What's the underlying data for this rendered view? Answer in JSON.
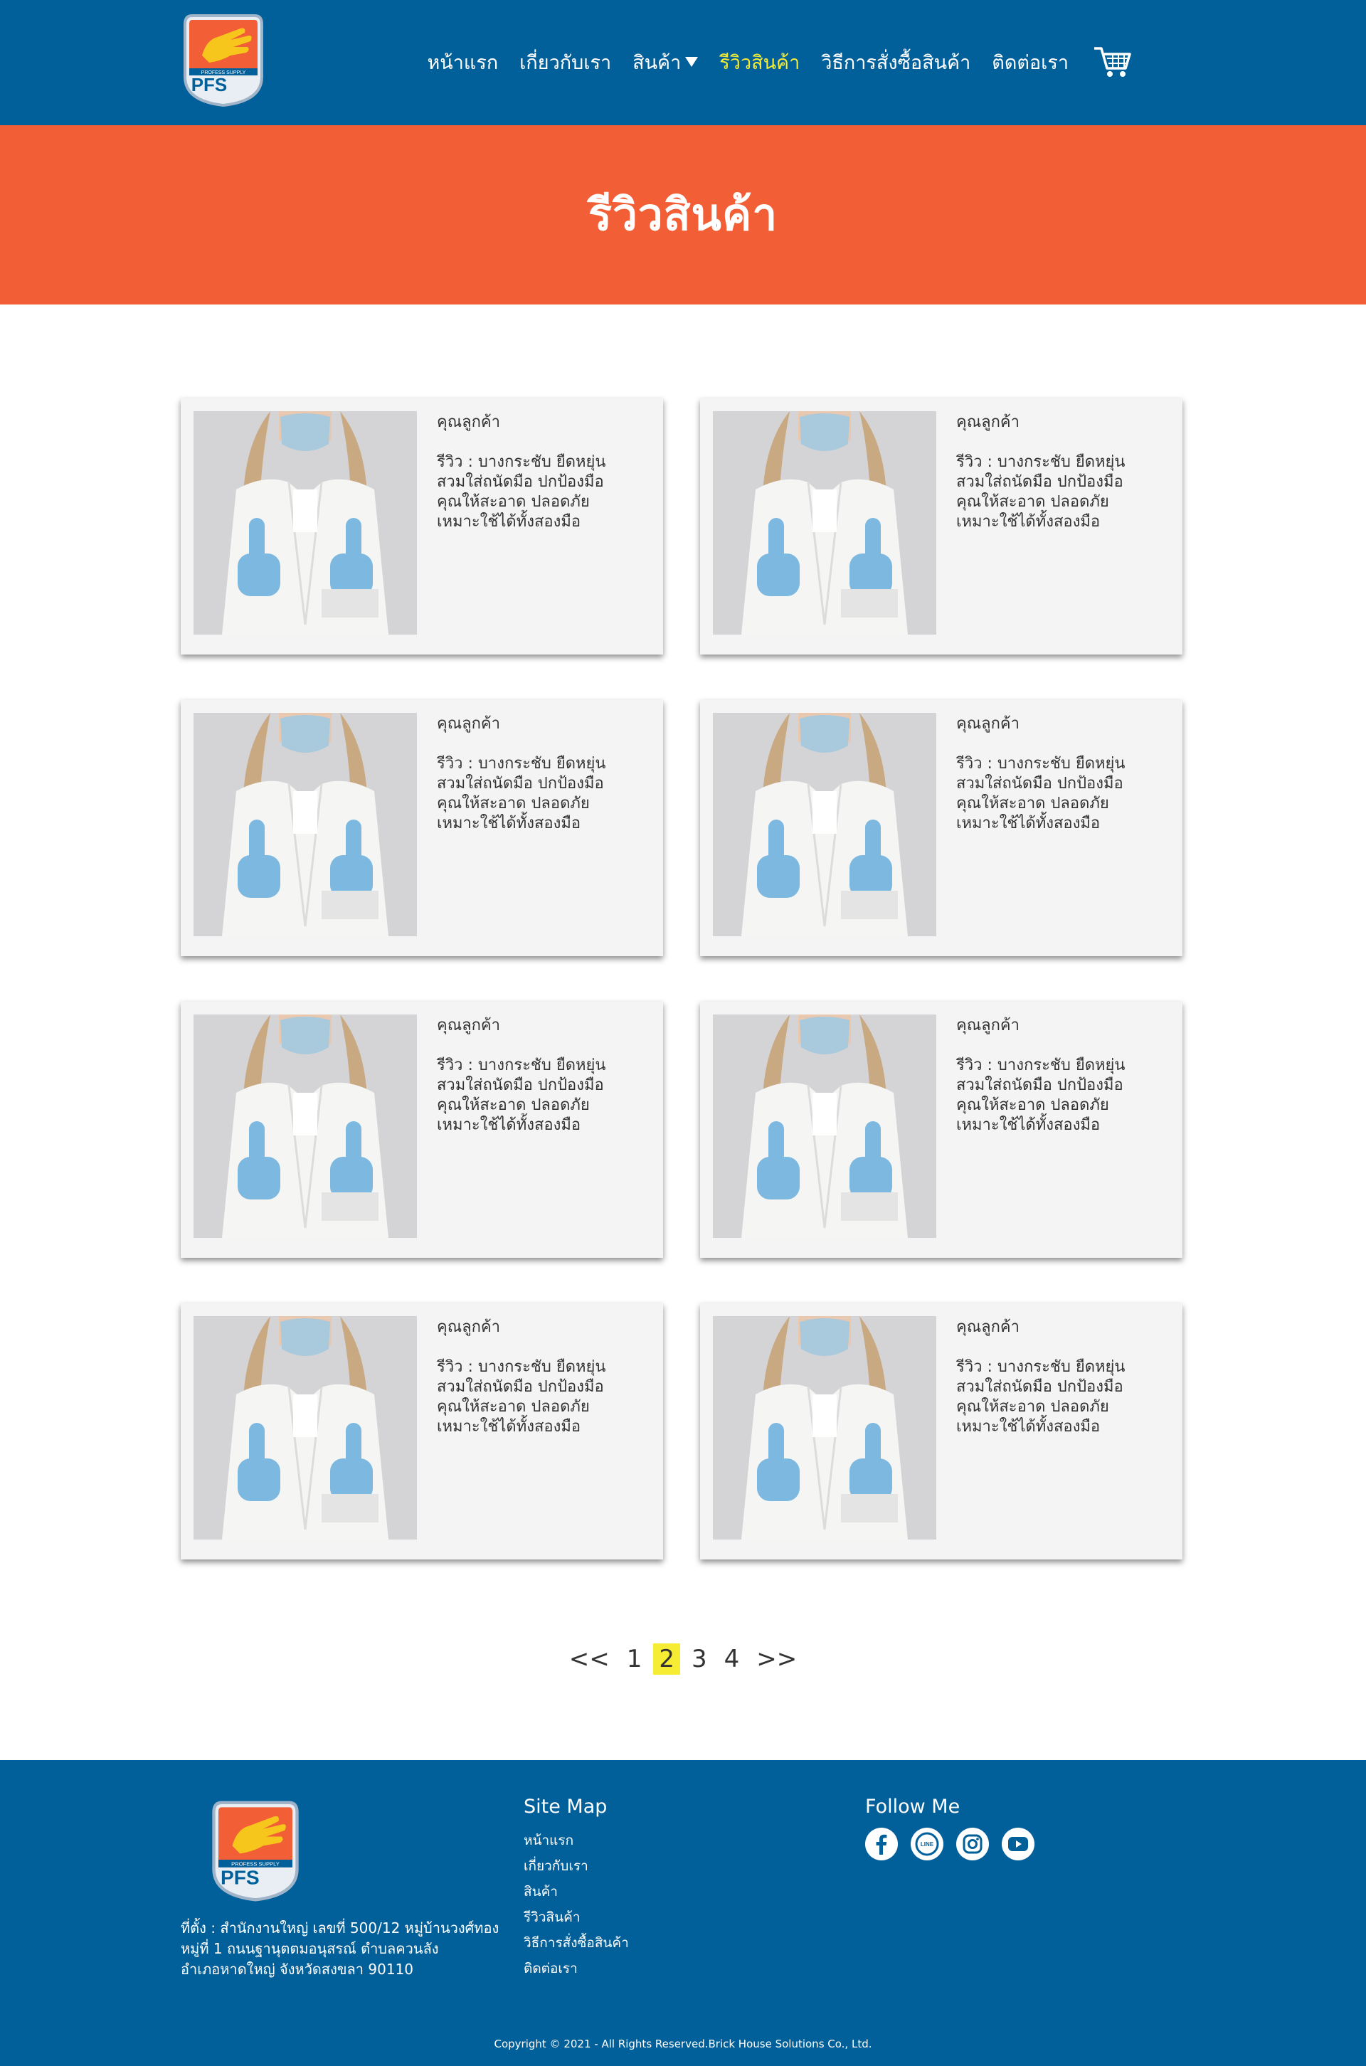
{
  "header": {
    "logo_text": "PFS",
    "logo_ribbon": "PROFESS SUPPLY",
    "nav": [
      {
        "label": "หน้าแรก",
        "active": false
      },
      {
        "label": "เกี่ยวกับเรา",
        "active": false
      },
      {
        "label": "สินค้า",
        "active": false,
        "dropdown": true
      },
      {
        "label": "รีวิวสินค้า",
        "active": true
      },
      {
        "label": "วิธีการสั่งซื้อสินค้า",
        "active": false
      },
      {
        "label": "ติดต่อเรา",
        "active": false
      }
    ],
    "cart_icon": "shopping-cart-icon"
  },
  "hero": {
    "title": "รีวิวสินค้า"
  },
  "reviews": [
    {
      "name": "คุณลูกค้า",
      "review": "รีวิว : บางกระชับ ยืดหยุ่น\nสวมใส่ถนัดมือ ปกป้องมือ\nคุณให้สะอาด ปลอดภัย\nเหมาะใช้ได้ทั้งสองมือ"
    },
    {
      "name": "คุณลูกค้า",
      "review": "รีวิว : บางกระชับ ยืดหยุ่น\nสวมใส่ถนัดมือ ปกป้องมือ\nคุณให้สะอาด ปลอดภัย\nเหมาะใช้ได้ทั้งสองมือ"
    },
    {
      "name": "คุณลูกค้า",
      "review": "รีวิว : บางกระชับ ยืดหยุ่น\nสวมใส่ถนัดมือ ปกป้องมือ\nคุณให้สะอาด ปลอดภัย\nเหมาะใช้ได้ทั้งสองมือ"
    },
    {
      "name": "คุณลูกค้า",
      "review": "รีวิว : บางกระชับ ยืดหยุ่น\nสวมใส่ถนัดมือ ปกป้องมือ\nคุณให้สะอาด ปลอดภัย\nเหมาะใช้ได้ทั้งสองมือ"
    },
    {
      "name": "คุณลูกค้า",
      "review": "รีวิว : บางกระชับ ยืดหยุ่น\nสวมใส่ถนัดมือ ปกป้องมือ\nคุณให้สะอาด ปลอดภัย\nเหมาะใช้ได้ทั้งสองมือ"
    },
    {
      "name": "คุณลูกค้า",
      "review": "รีวิว : บางกระชับ ยืดหยุ่น\nสวมใส่ถนัดมือ ปกป้องมือ\nคุณให้สะอาด ปลอดภัย\nเหมาะใช้ได้ทั้งสองมือ"
    },
    {
      "name": "คุณลูกค้า",
      "review": "รีวิว : บางกระชับ ยืดหยุ่น\nสวมใส่ถนัดมือ ปกป้องมือ\nคุณให้สะอาด ปลอดภัย\nเหมาะใช้ได้ทั้งสองมือ"
    },
    {
      "name": "คุณลูกค้า",
      "review": "รีวิว : บางกระชับ ยืดหยุ่น\nสวมใส่ถนัดมือ ปกป้องมือ\nคุณให้สะอาด ปลอดภัย\nเหมาะใช้ได้ทั้งสองมือ"
    }
  ],
  "pagination": {
    "prev": "<<",
    "pages": [
      "1",
      "2",
      "3",
      "4"
    ],
    "current": "2",
    "next": ">>"
  },
  "footer": {
    "address": [
      "ที่ตั้ง : สำนักงานใหญ่ เลขที่ 500/12 หมู่บ้านวงศ์ทอง",
      "หมู่ที่ 1 ถนนฐานุตตมอนุสรณ์ ตำบลควนลัง",
      "อำเภอหาดใหญ่ จังหวัดสงขลา 90110"
    ],
    "sitemap_title": "Site Map",
    "sitemap_links": [
      "หน้าแรก",
      "เกี่ยวกับเรา",
      "สินค้า",
      "รีวิวสินค้า",
      "วิธีการสั่งซื้อสินค้า",
      "ติดต่อเรา"
    ],
    "follow_title": "Follow Me",
    "social": [
      "facebook-icon",
      "line-icon",
      "instagram-icon",
      "youtube-icon"
    ],
    "line_label": "LINE",
    "copyright": "Copyright © 2021 -  All Rights Reserved.Brick House Solutions Co., Ltd."
  },
  "colors": {
    "header_bg": "#015f9a",
    "hero_bg": "#f25e35",
    "active_nav": "#f6ec34",
    "card_bg": "#f4f4f4",
    "footer_bg": "#015f9a"
  }
}
